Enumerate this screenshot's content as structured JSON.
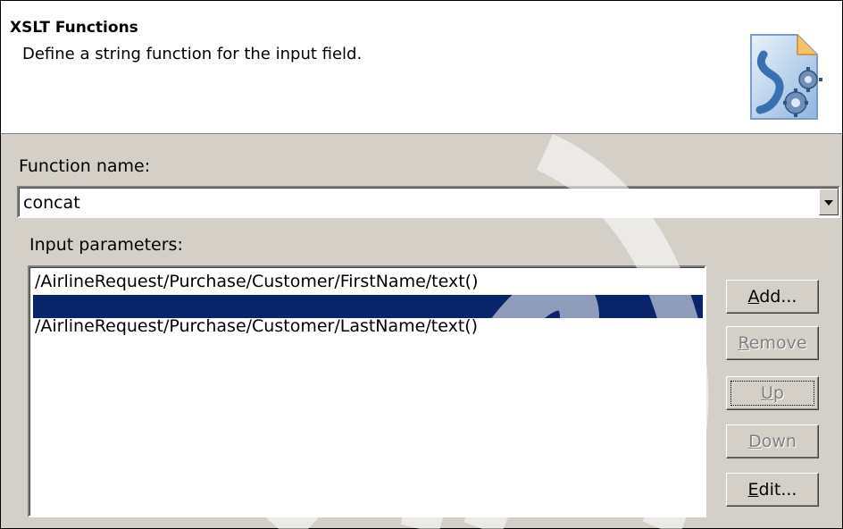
{
  "header": {
    "title": "XSLT Functions",
    "description": "Define a string function for the input field."
  },
  "function_name": {
    "label": "Function name:",
    "value": "concat"
  },
  "input_parameters": {
    "label": "Input parameters:",
    "items": [
      "/AirlineRequest/Purchase/Customer/FirstName/text()",
      "",
      "/AirlineRequest/Purchase/Customer/LastName/text()"
    ],
    "selected_index": 1
  },
  "buttons": {
    "add": {
      "label": "Add...",
      "mnemonic": "A",
      "rest": "dd..."
    },
    "remove": {
      "label": "Remove",
      "mnemonic": "R",
      "rest": "emove"
    },
    "up": {
      "label": "Up",
      "mnemonic": "U",
      "rest": "p"
    },
    "down": {
      "label": "Down",
      "mnemonic": "D",
      "rest": "own"
    },
    "edit": {
      "label": "Edit...",
      "mnemonic": "E",
      "rest": "dit..."
    }
  },
  "colors": {
    "selection": "#0a246a",
    "dialog_bg": "#d4d0c8"
  }
}
